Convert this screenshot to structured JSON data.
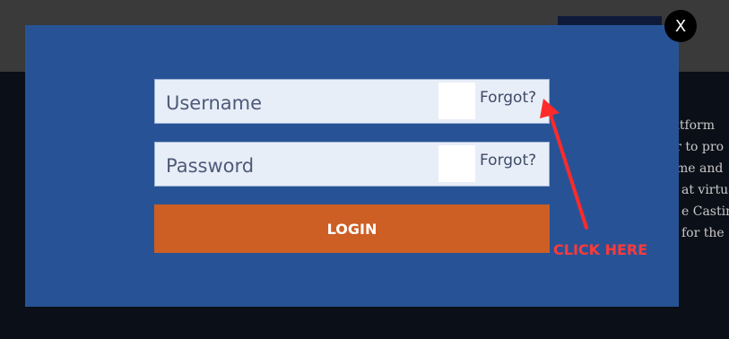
{
  "background": {
    "text_lines": [
      "latform",
      "er to pro",
      "ume and",
      "at virtua",
      "e Castin",
      "for the"
    ]
  },
  "modal": {
    "close_label": "X",
    "username": {
      "placeholder": "Username",
      "forgot_label": "Forgot?"
    },
    "password": {
      "placeholder": "Password",
      "forgot_label": "Forgot?"
    },
    "login_label": "LOGIN"
  },
  "annotation": {
    "label": "CLICK HERE",
    "color": "#ff3a3a"
  },
  "colors": {
    "modal_bg": "#275396",
    "field_bg": "#e8eef8",
    "login_bg": "#cd5e24",
    "header_bg": "#3a3a3a"
  }
}
